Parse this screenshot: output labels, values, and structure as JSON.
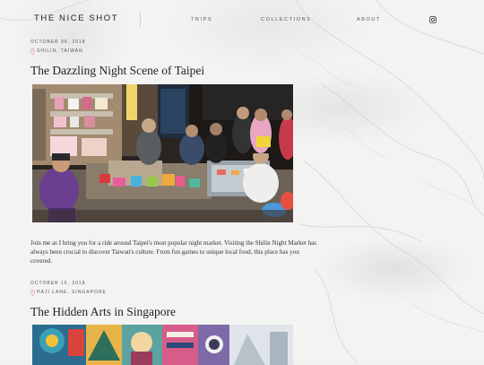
{
  "site": {
    "logo": "THE NICE SHOT",
    "nav": [
      {
        "label": "TRIPS"
      },
      {
        "label": "COLLECTIONS"
      },
      {
        "label": "ABOUT"
      }
    ],
    "social_icon": "instagram-icon"
  },
  "posts": [
    {
      "date": "OCTOBER 30, 2018",
      "location": "SHILIN, TAIWAN",
      "title": "The Dazzling Night Scene of Taipei",
      "excerpt": "Join me as I bring you for a ride around Taipei's most popular night market. Visiting the Shilin Night Market has always been crucial to discover Taiwan's culture. From fun games to unique local food, this place has you covered."
    },
    {
      "date": "OCTOBER 16, 2018",
      "location": "HAJI LANE, SINGAPORE",
      "title": "The Hidden Arts in Singapore"
    }
  ],
  "colors": {
    "background": "#f1f1f0",
    "text": "#222222",
    "pin_accent": "#e39aa8"
  }
}
